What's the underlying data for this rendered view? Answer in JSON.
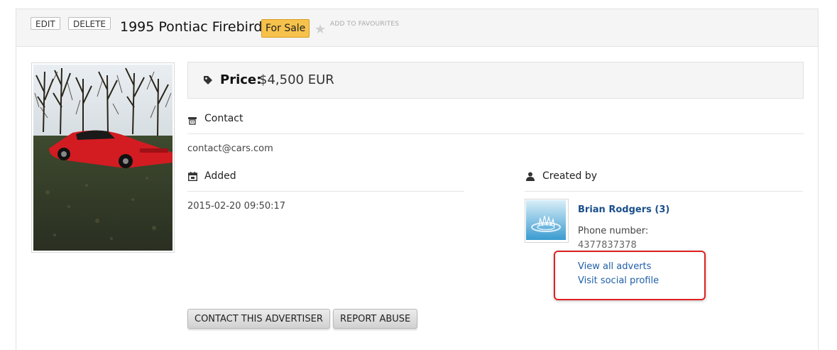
{
  "header": {
    "edit_label": "EDIT",
    "delete_label": "DELETE",
    "title": "1995 Pontiac Firebird",
    "status_badge": "For Sale",
    "favourite_label": "ADD TO FAVOURITES",
    "favourite_icon": "star-icon"
  },
  "price": {
    "icon": "tag-icon",
    "label": "Price:",
    "value": "$4,500 EUR"
  },
  "contact": {
    "icon": "phone-icon",
    "title": "Contact",
    "email": "contact@cars.com"
  },
  "added": {
    "icon": "calendar-icon",
    "title": "Added",
    "date": "2015-02-20 09:50:17"
  },
  "created_by": {
    "icon": "user-icon",
    "title": "Created by",
    "user_name": "Brian Rodgers (3)",
    "phone_label": "Phone number:",
    "phone_value": "4377837378",
    "view_adverts_link": "View all adverts",
    "social_profile_link": "Visit social profile"
  },
  "actions": {
    "contact_button": "CONTACT THIS ADVERTISER",
    "report_button": "REPORT ABUSE"
  },
  "colors": {
    "badge_bg": "#f7c24c",
    "link": "#1f5fa8",
    "highlight": "#e02020"
  }
}
